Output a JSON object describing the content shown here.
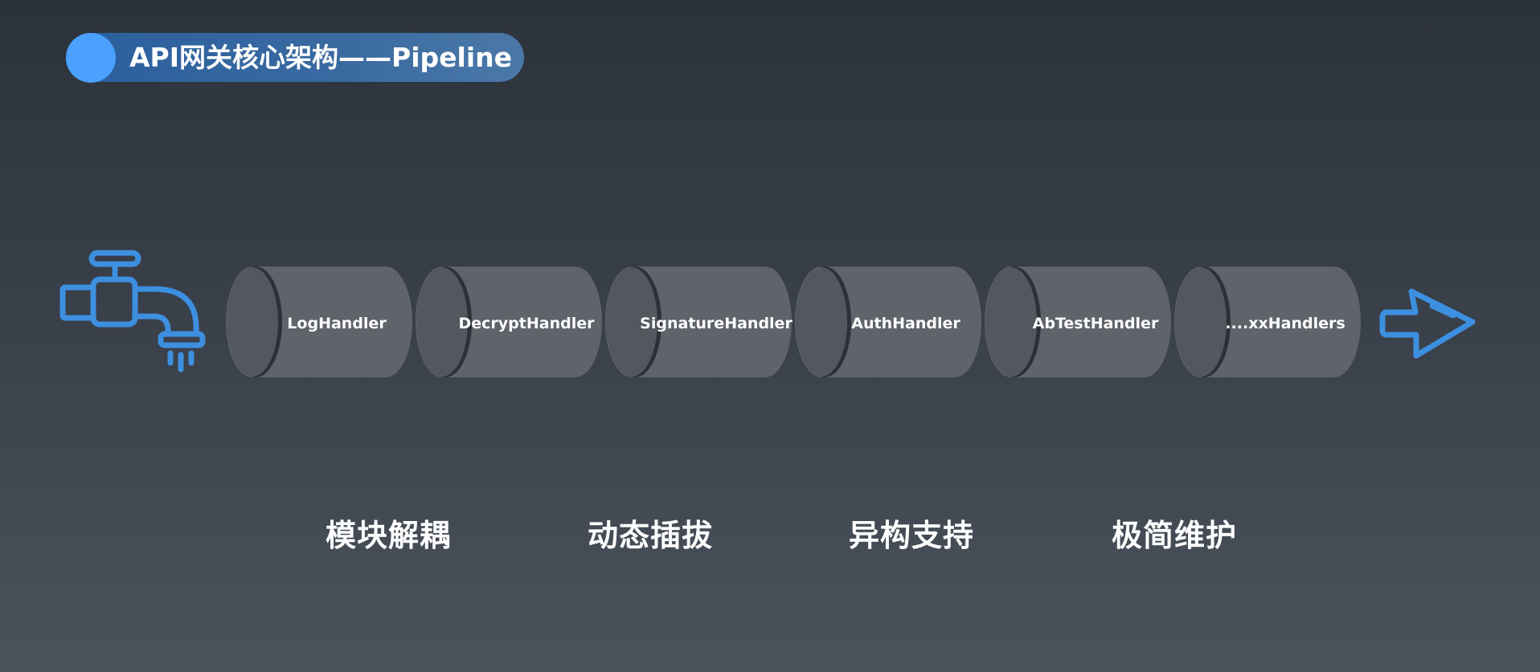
{
  "title": "API网关核心架构——Pipeline",
  "handlers": [
    {
      "label": "LogHandler"
    },
    {
      "label": "DecryptHandler"
    },
    {
      "label": "SignatureHandler"
    },
    {
      "label": "AuthHandler"
    },
    {
      "label": "AbTestHandler"
    },
    {
      "label": "....xxHandlers"
    }
  ],
  "features": [
    "模块解耦",
    "动态插拔",
    "异构支持",
    "极简维护"
  ],
  "icons": {
    "source": "faucet-icon",
    "output": "arrow-right-icon"
  },
  "colors": {
    "accent": "#4aa1ff",
    "icon_stroke": "#3d8fe0",
    "pill": "#2f64a0",
    "pipe_body": "#5f646b",
    "pipe_face": "#53585f",
    "pipe_edge": "#2c3038"
  }
}
